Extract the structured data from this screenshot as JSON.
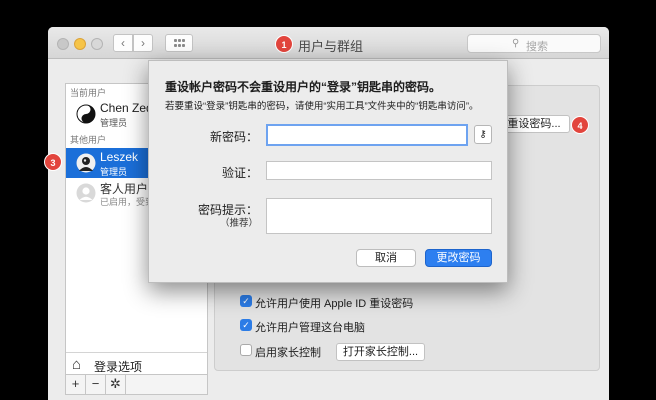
{
  "window": {
    "title": "用户与群组",
    "search_placeholder": "搜索"
  },
  "sidebar": {
    "current_header": "当前用户",
    "other_header": "其他用户",
    "users": [
      {
        "name": "Chen Zedo",
        "role": "管理员",
        "avatar": "yin-yang-avatar"
      },
      {
        "name": "Leszek",
        "role": "管理员",
        "avatar": "portrait-avatar",
        "selected": true
      },
      {
        "name": "客人用户",
        "role": "已启用，受到",
        "avatar": "guest-avatar"
      }
    ],
    "login_options": "登录选项"
  },
  "tools": {
    "add": "+",
    "remove": "−",
    "gear": "✲"
  },
  "content": {
    "reset_button": "重设密码...",
    "checkboxes": [
      {
        "label": "允许用户使用 Apple ID 重设密码",
        "checked": true
      },
      {
        "label": "允许用户管理这台电脑",
        "checked": true
      },
      {
        "label": "启用家长控制",
        "checked": false
      }
    ],
    "parental_button": "打开家长控制..."
  },
  "badges": {
    "title": "1",
    "sidebar": "3",
    "reset": "4"
  },
  "dialog": {
    "title": "重设帐户密码不会重设用户的“登录”钥匙串的密码。",
    "subtitle": "若要重设“登录”钥匙串的密码，请使用“实用工具”文件夹中的“钥匙串访问”。",
    "new_password_label": "新密码：",
    "verify_label": "验证：",
    "hint_label": "密码提示：",
    "hint_sub": "（推荐）",
    "cancel": "取消",
    "confirm": "更改密码"
  },
  "colors": {
    "accent": "#2d7ff0",
    "selection": "#1b6fd9",
    "badge": "#e2453d"
  }
}
